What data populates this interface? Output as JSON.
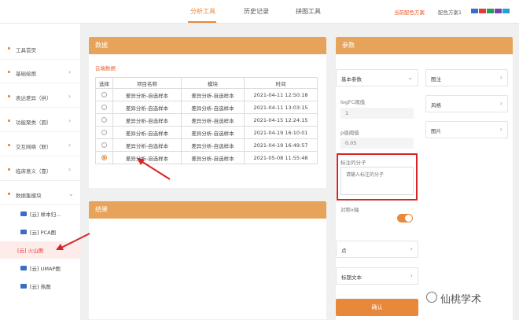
{
  "header": {
    "tabs": [
      {
        "label": "分析工具",
        "active": true
      },
      {
        "label": "历史记录",
        "active": false
      },
      {
        "label": "拼图工具",
        "active": false
      }
    ],
    "current_scheme": "当前配色方案",
    "scheme_label": "配色方案1",
    "swatch_colors": [
      "#3d6cc4",
      "#e33a3a",
      "#2e9a55",
      "#7a3fb0",
      "#2a9fd6"
    ]
  },
  "sidebar": {
    "items": [
      {
        "label": "工具首页"
      },
      {
        "label": "基础绘图"
      },
      {
        "label": "表达差异（拱）"
      },
      {
        "label": "功能聚类（圆）"
      },
      {
        "label": "交互网络（联）"
      },
      {
        "label": "临床意义（靠）"
      },
      {
        "label": "数据集模块"
      }
    ],
    "subitems": [
      {
        "label": "[云] 样本归..."
      },
      {
        "label": "[云] PCA图"
      },
      {
        "label": "[云] 火山图",
        "active": true
      },
      {
        "label": "[云] UMAP图"
      },
      {
        "label": "[云] 热图"
      }
    ]
  },
  "data_panel": {
    "title": "数据",
    "link": "云端数据",
    "columns": [
      "选择",
      "项目名称",
      "模块",
      "时间"
    ],
    "rows": [
      {
        "name": "差异分析-自选样本",
        "module": "差异分析-自选样本",
        "time": "2021-04-11 12:50:18",
        "selected": false
      },
      {
        "name": "差异分析-自选样本",
        "module": "差异分析-自选样本",
        "time": "2021-04-11 13:03:15",
        "selected": false
      },
      {
        "name": "差异分析-自选样本",
        "module": "差异分析-自选样本",
        "time": "2021-04-15 12:24:15",
        "selected": false
      },
      {
        "name": "差异分析-自选样本",
        "module": "差异分析-自选样本",
        "time": "2021-04-19 16:10:01",
        "selected": false
      },
      {
        "name": "差异分析-自选样本",
        "module": "差异分析-自选样本",
        "time": "2021-04-19 16:49:57",
        "selected": false
      },
      {
        "name": "差异分析-自选样本",
        "module": "差异分析-自选样本",
        "time": "2021-05-08 11:55:48",
        "selected": true
      }
    ]
  },
  "result_panel": {
    "title": "结果"
  },
  "param_panel": {
    "title": "参数",
    "basic": "基本参数",
    "logfc_label": "logFC阈值",
    "logfc_value": "1",
    "p_label": "p值阈值",
    "p_value": "0.05",
    "label_genes": "标注的分子",
    "label_placeholder": "请输入标注的分子",
    "symmetric": "对称x轴",
    "point": "点",
    "title_text": "标题文本",
    "annotation": "图注",
    "style": "风格",
    "image": "图片",
    "confirm": "确认"
  },
  "watermark": "仙桃学术"
}
